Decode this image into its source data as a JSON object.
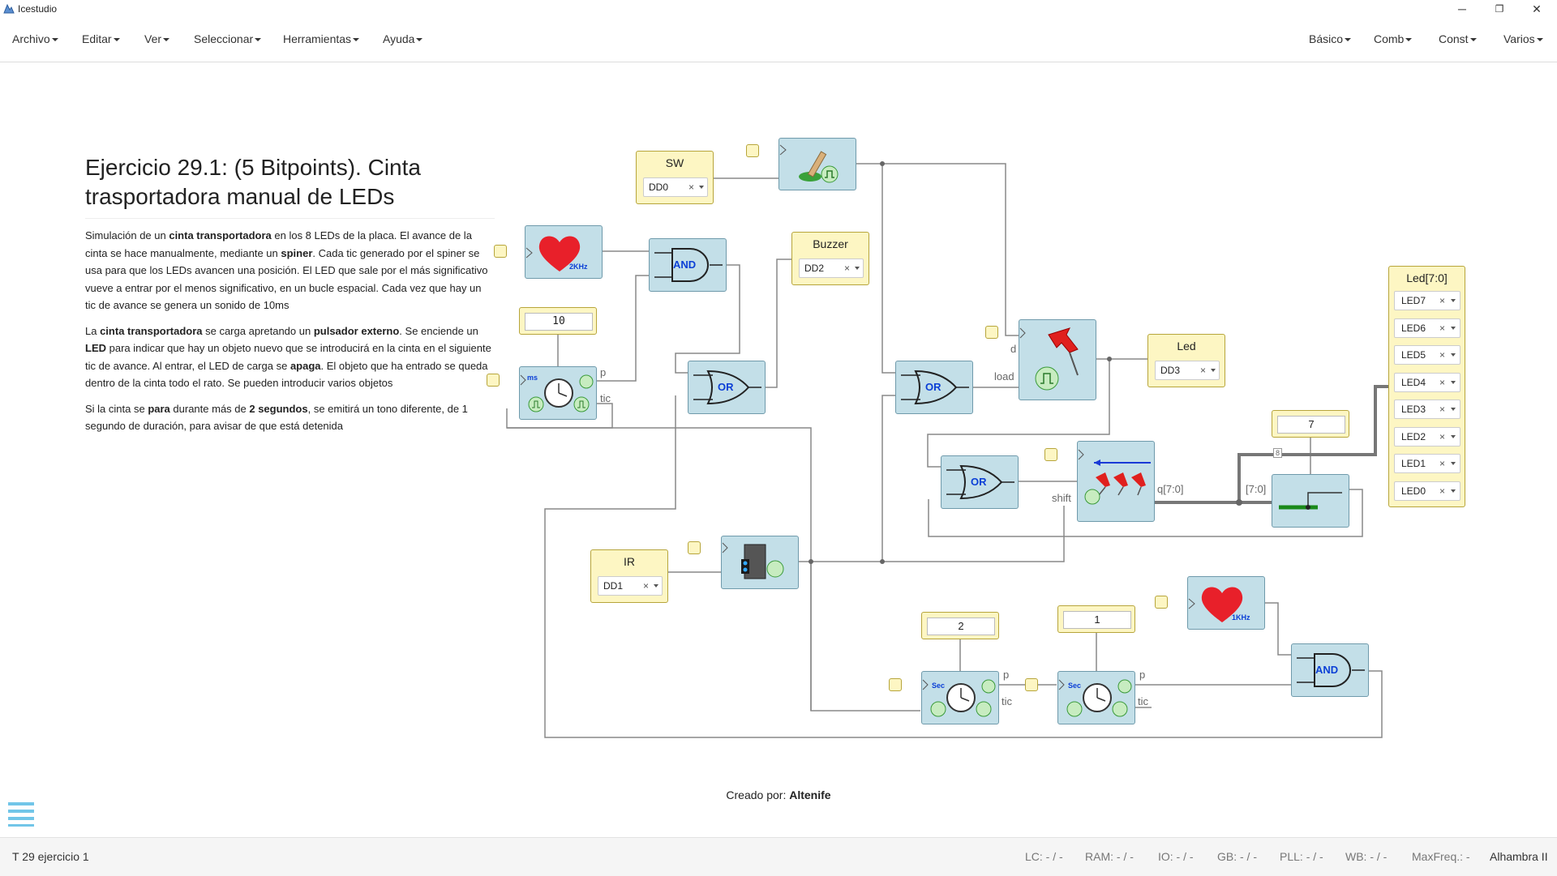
{
  "window": {
    "title": "Icestudio",
    "minimize": "─",
    "restore": "❐",
    "close": "✕"
  },
  "menu_left": [
    "Archivo",
    "Editar",
    "Ver",
    "Seleccionar",
    "Herramientas",
    "Ayuda"
  ],
  "menu_right": [
    "Básico",
    "Comb",
    "Const",
    "Varios"
  ],
  "description": {
    "title": "Ejercicio 29.1: (5 Bitpoints). Cinta trasportadora manual de LEDs",
    "p1": [
      {
        "t": "Simulación de un "
      },
      {
        "t": "cinta transportadora",
        "b": true
      },
      {
        "t": " en los 8 LEDs de la placa. El avance de la cinta se hace manualmente, mediante un "
      },
      {
        "t": "spiner",
        "b": true
      },
      {
        "t": ". Cada tic generado por el spiner se usa para que los LEDs avancen una posición. El LED que sale por el más significativo vueve a entrar por el menos significativo, en un bucle espacial. Cada vez que hay un tic de avance se genera un sonido de 10ms"
      }
    ],
    "p2": [
      {
        "t": "La "
      },
      {
        "t": "cinta transportadora",
        "b": true
      },
      {
        "t": " se carga apretando un "
      },
      {
        "t": "pulsador externo",
        "b": true
      },
      {
        "t": ". Se enciende un "
      },
      {
        "t": "LED",
        "b": true
      },
      {
        "t": " para indicar que hay un objeto nuevo que se introducirá en la cinta en el siguiente tic de avance. Al entrar, el LED de carga se "
      },
      {
        "t": "apaga",
        "b": true
      },
      {
        "t": ". El objeto que ha entrado se queda dentro de la cinta todo el rato. Se pueden introducir varios objetos"
      }
    ],
    "p3": [
      {
        "t": "Si la cinta se "
      },
      {
        "t": "para",
        "b": true
      },
      {
        "t": " durante más de "
      },
      {
        "t": "2 segundos",
        "b": true
      },
      {
        "t": ", se emitirá un tono diferente, de 1 segundo de duración, para avisar de que está detenida"
      }
    ]
  },
  "blocks": {
    "sw": {
      "label": "SW",
      "pin": "DD0"
    },
    "buzzer": {
      "label": "Buzzer",
      "pin": "DD2"
    },
    "ir": {
      "label": "IR",
      "pin": "DD1"
    },
    "led": {
      "label": "Led",
      "pin": "DD3"
    },
    "ledbus": {
      "label": "Led[7:0]",
      "pins": [
        "LED7",
        "LED6",
        "LED5",
        "LED4",
        "LED3",
        "LED2",
        "LED1",
        "LED0"
      ]
    },
    "heart_2k": "2KHz",
    "heart_1k": "1KHz",
    "and_label": "AND",
    "or_label": "OR",
    "timer_ms": "ms",
    "timer_sec": "Sec",
    "const_10": "10",
    "const_7": "7",
    "const_2": "2",
    "const_1": "1",
    "port_p": "p",
    "port_tic": "tic",
    "port_d": "d",
    "port_load": "load",
    "port_shift": "shift",
    "port_q": "q[7:0]",
    "port_bus_in": "[7:0]",
    "bus_width": "8",
    "pin_clear": "×"
  },
  "footer": {
    "created_by_label": "Creado por:",
    "author": "Altenife"
  },
  "status": {
    "project": "T 29 ejercicio 1",
    "lc": "LC:  - / -",
    "ram": "RAM:  - / -",
    "io": "IO:  - / -",
    "gb": "GB:  - / -",
    "pll": "PLL:  - / -",
    "wb": "WB:  - / -",
    "maxfreq": "MaxFreq.:  -",
    "board": "Alhambra II"
  },
  "colors": {
    "block_bg": "#c3dfe8",
    "pin_bg": "#fdf6c3",
    "wire": "#888888",
    "bus": "#777777",
    "heart": "#e8202a",
    "gate_text": "#0b3fd6"
  }
}
